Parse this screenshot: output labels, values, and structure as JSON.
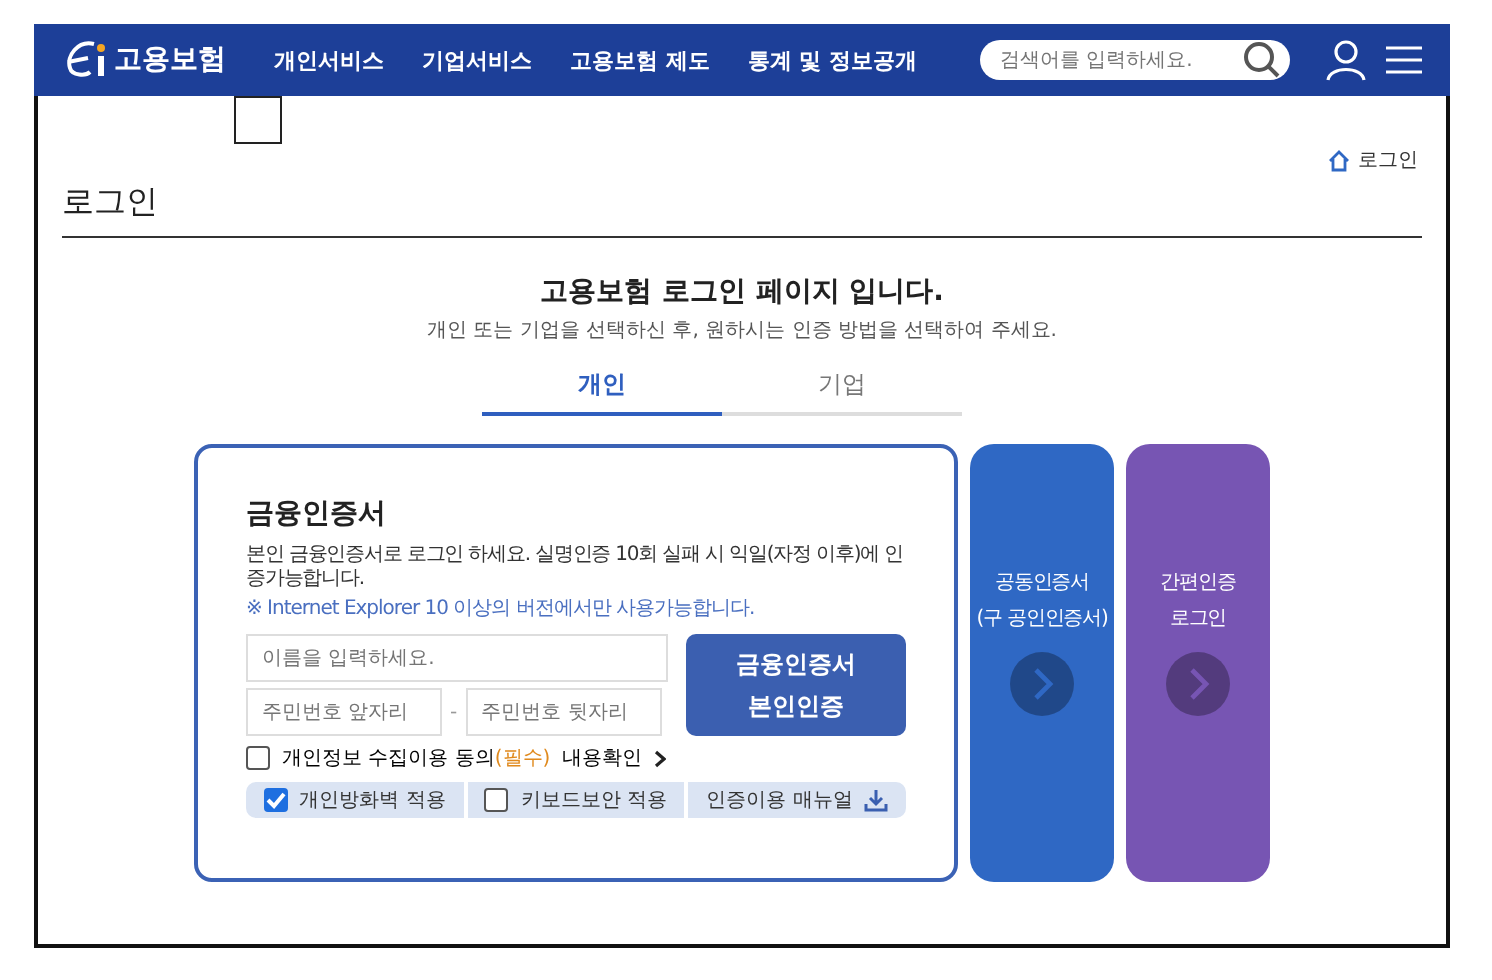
{
  "header": {
    "logo": "고용보험",
    "nav": [
      "개인서비스",
      "기업서비스",
      "고용보험 제도",
      "통계 및 정보공개"
    ],
    "search": {
      "placeholder": "검색어를 입력하세요."
    }
  },
  "breadcrumb": [
    "로그인"
  ],
  "page_title": "로그인",
  "intro": {
    "title": "고용보험 로그인 페이지 입니다.",
    "subtitle": "개인 또는 기업을 선택하신 후, 원하시는 인증 방법을 선택하여 주세요."
  },
  "tabs": [
    {
      "label": "개인",
      "selected": true
    },
    {
      "label": "기업",
      "selected": false
    }
  ],
  "login_card": {
    "title": "금융인증서",
    "description": "본인 금융인증서로 로그인 하세요. 실명인증 10회 실패 시 익일(자정 이후)에 인증가능합니다.",
    "note": "※ Internet Explorer 10 이상의 버전에서만 사용가능합니다.",
    "name_field": {
      "placeholder": "이름을 입력하세요."
    },
    "id_front_field": {
      "placeholder": "주민번호 앞자리"
    },
    "separator": "-",
    "id_back_field": {
      "placeholder": "주민번호 뒷자리"
    },
    "submit_button": [
      "금융인증서",
      "본인인증"
    ],
    "consent": {
      "label": "개인정보 수집이용 동의",
      "required": "(필수)",
      "checked": false,
      "link": "내용확인"
    },
    "options": [
      {
        "kind": "checkbox",
        "label": "개인방화벽 적용",
        "checked": true
      },
      {
        "kind": "checkbox",
        "label": "키보드보안 적용",
        "checked": false
      },
      {
        "kind": "download",
        "label": "인증이용 매뉴얼"
      }
    ]
  },
  "side_panels": [
    {
      "lines": [
        "공동인증서",
        "(구 공인인증서)"
      ],
      "color": "#2f68c4"
    },
    {
      "lines": [
        "간편인증",
        "로그인"
      ],
      "color": "#7755b3"
    }
  ]
}
